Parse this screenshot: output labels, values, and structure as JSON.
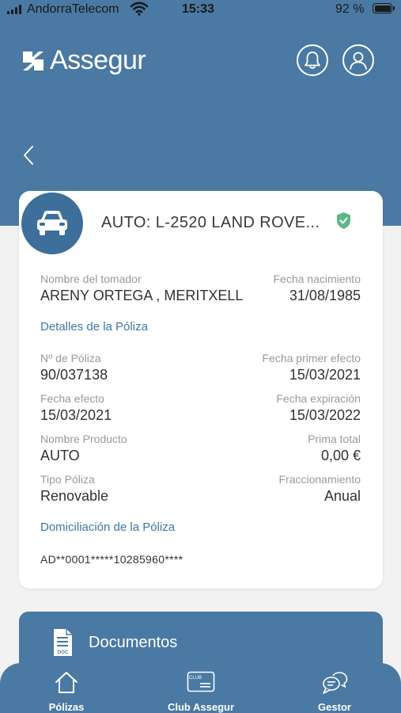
{
  "status": {
    "carrier": "AndorraTelecom",
    "time": "15:33",
    "battery": "92 %"
  },
  "header": {
    "logo_text": "Assegur"
  },
  "policy": {
    "title": "AUTO: L-2520 LAND ROVE...",
    "holder_label": "Nombre del tomador",
    "holder_value": "ARENY ORTEGA , MERITXELL",
    "birth_label": "Fecha nacimiento",
    "birth_value": "31/08/1985",
    "details_link": "Detalles de la Póliza",
    "number_label": "Nº de Póliza",
    "number_value": "90/037138",
    "first_effect_label": "Fecha primer efecto",
    "first_effect_value": "15/03/2021",
    "effect_label": "Fecha efecto",
    "effect_value": "15/03/2021",
    "expiry_label": "Fecha expiración",
    "expiry_value": "15/03/2022",
    "product_label": "Nombre Producto",
    "product_value": "AUTO",
    "premium_label": "Prima total",
    "premium_value": "0,00 €",
    "type_label": "Tipo Póliza",
    "type_value": "Renovable",
    "split_label": "Fraccionamiento",
    "split_value": "Anual",
    "domicile_link": "Domiciliación de la Póliza",
    "iban": "AD**0001*****10285960****"
  },
  "documents": {
    "label": "Documentos",
    "icon_text": "DOC"
  },
  "nav": [
    {
      "label": "Pólizas",
      "icon": "home-icon"
    },
    {
      "label": "Club Assegur",
      "icon": "club-card-icon",
      "icon_text": "CLUB"
    },
    {
      "label": "Gestor",
      "icon": "chat-bubbles-icon"
    }
  ],
  "colors": {
    "brand": "#4a79a3",
    "accent_link": "#3d77a8",
    "verified": "#5cb88a"
  }
}
